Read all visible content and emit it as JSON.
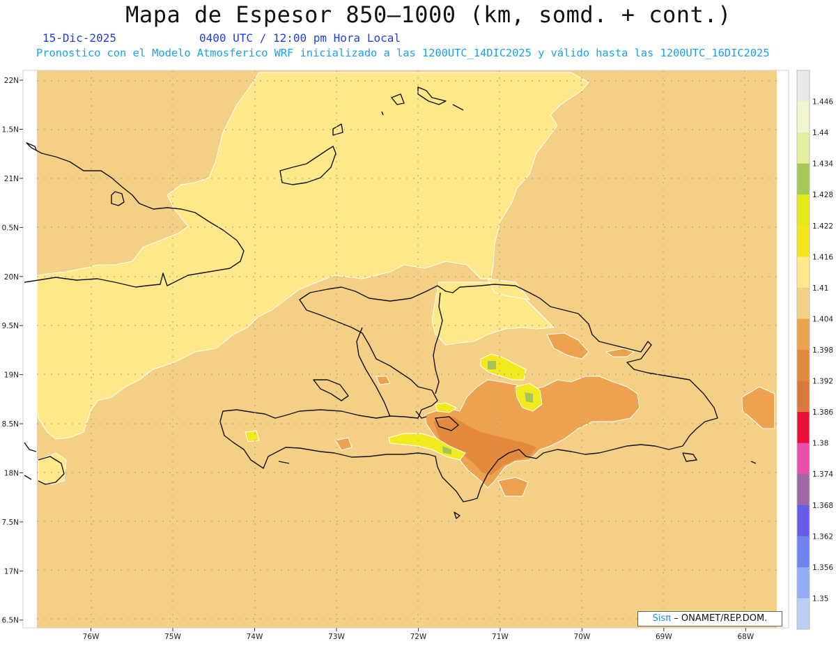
{
  "header": {
    "title": "Mapa de Espesor 850—1000 (km, somd. + cont.)",
    "date": "15-Dic-2025",
    "time": "0400 UTC / 12:00 pm Hora Local",
    "description": "Pronostico con el Modelo Atmosferico WRF inicializado a las 1200UTC_14DIC2025 y válido hasta las  1200UTC_16DIC2025"
  },
  "credit": {
    "logo": "Sisπ",
    "org": "– ONAMET/REP.DOM."
  },
  "map": {
    "lat_labels": [
      "22N",
      "1.5N",
      "21N",
      "0.5N",
      "20N",
      "9.5N",
      "19N",
      "8.5N",
      "18N",
      "7.5N",
      "17N",
      "6.5N"
    ],
    "lon_labels": [
      "76W",
      "75W",
      "74W",
      "73W",
      "72W",
      "71W",
      "70W",
      "69W",
      "68W"
    ],
    "lat_values": [
      22,
      21.5,
      21,
      20.5,
      20,
      19.5,
      19,
      18.5,
      18,
      17.5,
      17,
      16.5
    ],
    "lon_values": [
      -76,
      -75,
      -74,
      -73,
      -72,
      -71,
      -70,
      -69,
      -68
    ],
    "lat_range": [
      16.42,
      22.1
    ],
    "lon_range": [
      -76.66,
      -67.62
    ],
    "colors": {
      "background": "#f3d085",
      "land_yellow": "#fde88a",
      "orange": "#eca24e",
      "dark_orange": "#e48a3f",
      "bright_yellow": "#f2ea1e",
      "green": "#a4c457",
      "coast": "#111111",
      "grid": "#9a9a9a"
    }
  },
  "colorbar": {
    "labels": [
      "1.446",
      "1.44",
      "1.434",
      "1.428",
      "1.422",
      "1.416",
      "1.41",
      "1.404",
      "1.398",
      "1.392",
      "1.386",
      "1.38",
      "1.374",
      "1.368",
      "1.362",
      "1.356",
      "1.35"
    ],
    "colors": [
      "#e9e9e9",
      "#f2f5cf",
      "#e3efa0",
      "#a6c75a",
      "#e2ea1a",
      "#f5e51a",
      "#fde88a",
      "#f3d085",
      "#eca24e",
      "#e48a3f",
      "#da7a3a",
      "#e8103a",
      "#e84fa8",
      "#9b6aa6",
      "#6a5ae8",
      "#6f82ee",
      "#93adf2",
      "#bccdf6"
    ]
  }
}
